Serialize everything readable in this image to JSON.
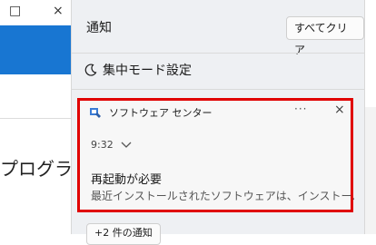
{
  "background_window": {
    "minimize_icon": "□",
    "close_icon": "×",
    "partial_text": "プログラム"
  },
  "panel": {
    "title": "通知",
    "clear_all_label": "すべてクリア",
    "focus": {
      "icon": "moon-icon",
      "label": "集中モード設定"
    },
    "notification": {
      "app_name": "ソフトウェア センター",
      "more_icon": "···",
      "close_icon": "×",
      "time": "9:32",
      "title": "再起動が必要",
      "body": "最近インストールされたソフトウェアは、インストールを完了"
    },
    "more_notifications_label": "+2 件の通知"
  },
  "colors": {
    "accent_blue": "#1876d2",
    "highlight_red": "#e00000",
    "panel_bg": "#eef0f3"
  }
}
